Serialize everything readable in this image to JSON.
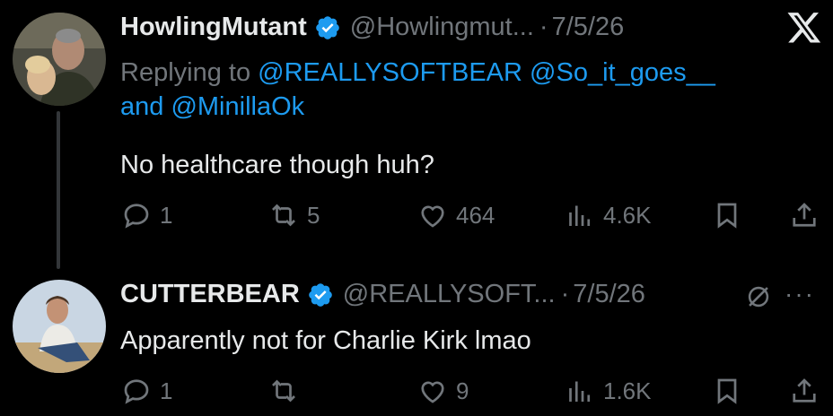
{
  "tweet1": {
    "display_name": "HowlingMutant",
    "handle": "@Howlingmut...",
    "dot": "·",
    "date": "7/5/26",
    "replying_prefix": "Replying to",
    "mention1": "@REALLYSOFTBEAR",
    "mention2": "@So_it_goes__",
    "and_text": "and",
    "mention3": "@MinillaOk",
    "text": "No healthcare though huh?",
    "replies": "1",
    "reposts": "5",
    "likes": "464",
    "views": "4.6K"
  },
  "tweet2": {
    "display_name": "CUTTERBEAR",
    "handle": "@REALLYSOFT...",
    "dot": "·",
    "date": "7/5/26",
    "text": "Apparently not for Charlie Kirk lmao",
    "replies": "1",
    "reposts": "",
    "likes": "9",
    "views": "1.6K",
    "more": "···"
  },
  "colors": {
    "background": "#000000",
    "text": "#e7e9ea",
    "muted": "#71767b",
    "link": "#1d9bf0",
    "verified": "#1d9bf0"
  },
  "icons": [
    "x-logo-icon",
    "verified-badge-icon",
    "reply-icon",
    "repost-icon",
    "like-icon",
    "views-icon",
    "bookmark-icon",
    "share-icon",
    "mute-icon",
    "more-icon"
  ]
}
